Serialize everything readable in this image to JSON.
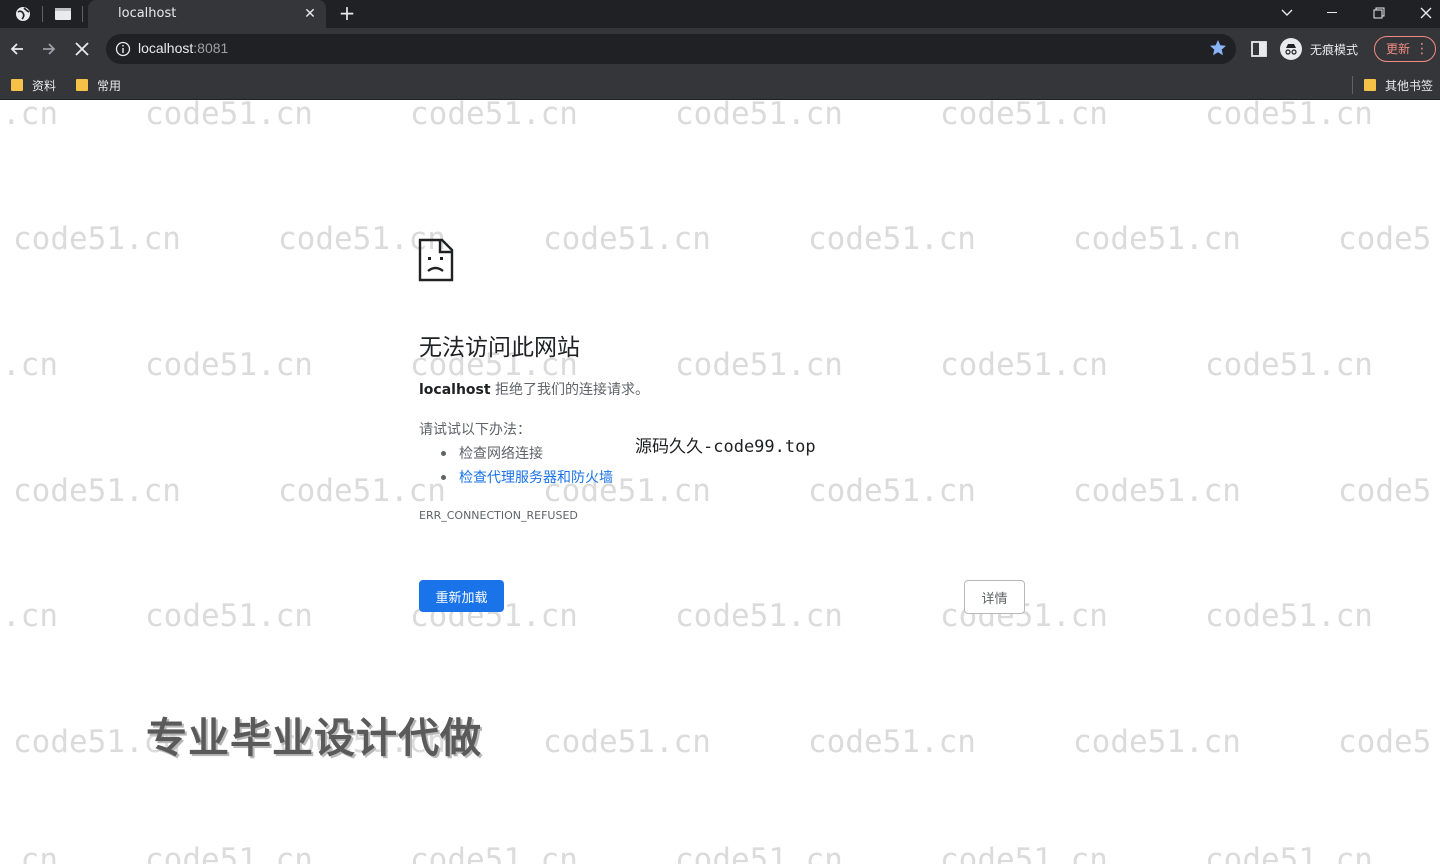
{
  "browser": {
    "tab": {
      "title": "localhost",
      "close_icon": "close-icon"
    },
    "address": {
      "host": "localhost",
      "port": ":8081"
    },
    "profile_label": "无痕模式",
    "update_label": "更新",
    "bookmarks": [
      {
        "label": "资料"
      },
      {
        "label": "常用"
      }
    ],
    "other_bookmarks_label": "其他书签"
  },
  "error_page": {
    "title": "无法访问此网站",
    "desc_host": "localhost",
    "desc_text": " 拒绝了我们的连接请求。",
    "try_label": "请试试以下办法：",
    "suggestions": [
      {
        "text": "检查网络连接",
        "is_link": false
      },
      {
        "text": "检查代理服务器和防火墙",
        "is_link": true
      }
    ],
    "error_code": "ERR_CONNECTION_REFUSED",
    "reload_label": "重新加载",
    "details_label": "详情"
  },
  "overlay": {
    "site_text": "源码久久-code99.top",
    "promo_text": "专业毕业设计代做",
    "watermark_text": "code51.cn",
    "watermark_fragment_left": ".cn",
    "watermark_fragment_right": "code5"
  },
  "colors": {
    "chrome_dark": "#202124",
    "chrome_toolbar": "#35363a",
    "link_blue": "#1a73e8",
    "update_red": "#f28b82",
    "folder_yellow": "#f5c146"
  }
}
